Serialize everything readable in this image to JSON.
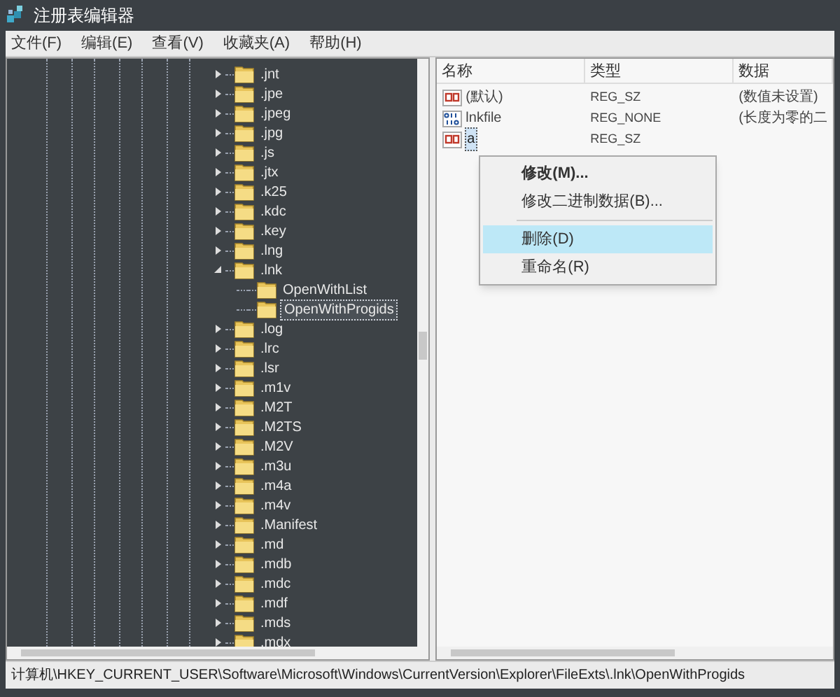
{
  "window": {
    "title": "注册表编辑器"
  },
  "menu": [
    "文件(F)",
    "编辑(E)",
    "查看(V)",
    "收藏夹(A)",
    "帮助(H)"
  ],
  "tree": [
    {
      "label": ".jnt",
      "expanded": false,
      "selected": false
    },
    {
      "label": ".jpe",
      "expanded": false,
      "selected": false
    },
    {
      "label": ".jpeg",
      "expanded": false,
      "selected": false
    },
    {
      "label": ".jpg",
      "expanded": false,
      "selected": false
    },
    {
      "label": ".js",
      "expanded": false,
      "selected": false
    },
    {
      "label": ".jtx",
      "expanded": false,
      "selected": false
    },
    {
      "label": ".k25",
      "expanded": false,
      "selected": false
    },
    {
      "label": ".kdc",
      "expanded": false,
      "selected": false
    },
    {
      "label": ".key",
      "expanded": false,
      "selected": false
    },
    {
      "label": ".lng",
      "expanded": false,
      "selected": false
    },
    {
      "label": ".lnk",
      "expanded": true,
      "selected": false,
      "children": [
        {
          "label": "OpenWithList",
          "selected": false
        },
        {
          "label": "OpenWithProgids",
          "selected": true
        }
      ]
    },
    {
      "label": ".log",
      "expanded": false,
      "selected": false
    },
    {
      "label": ".lrc",
      "expanded": false,
      "selected": false
    },
    {
      "label": ".lsr",
      "expanded": false,
      "selected": false
    },
    {
      "label": ".m1v",
      "expanded": false,
      "selected": false
    },
    {
      "label": ".M2T",
      "expanded": false,
      "selected": false
    },
    {
      "label": ".M2TS",
      "expanded": false,
      "selected": false
    },
    {
      "label": ".M2V",
      "expanded": false,
      "selected": false
    },
    {
      "label": ".m3u",
      "expanded": false,
      "selected": false
    },
    {
      "label": ".m4a",
      "expanded": false,
      "selected": false
    },
    {
      "label": ".m4v",
      "expanded": false,
      "selected": false
    },
    {
      "label": ".Manifest",
      "expanded": false,
      "selected": false
    },
    {
      "label": ".md",
      "expanded": false,
      "selected": false
    },
    {
      "label": ".mdb",
      "expanded": false,
      "selected": false
    },
    {
      "label": ".mdc",
      "expanded": false,
      "selected": false
    },
    {
      "label": ".mdf",
      "expanded": false,
      "selected": false
    },
    {
      "label": ".mds",
      "expanded": false,
      "selected": false
    },
    {
      "label": ".mdx",
      "expanded": false,
      "selected": false
    }
  ],
  "list": {
    "columns": [
      "名称",
      "类型",
      "数据"
    ],
    "rows": [
      {
        "kind": "string",
        "name": "(默认)",
        "type": "REG_SZ",
        "data": "(数值未设置)",
        "selected": false
      },
      {
        "kind": "binary",
        "name": "lnkfile",
        "type": "REG_NONE",
        "data": "(长度为零的二",
        "selected": false
      },
      {
        "kind": "string",
        "name": "a",
        "type": "REG_SZ",
        "selected": true
      }
    ]
  },
  "context_menu": [
    {
      "kind": "item",
      "label": "修改(M)...",
      "bold": true,
      "selected": false
    },
    {
      "kind": "item",
      "label": "修改二进制数据(B)...",
      "bold": false,
      "selected": false
    },
    {
      "kind": "separator"
    },
    {
      "kind": "item",
      "label": "删除(D)",
      "bold": false,
      "selected": true
    },
    {
      "kind": "item",
      "label": "重命名(R)",
      "bold": false,
      "selected": false
    }
  ],
  "status_bar": "计算机\\HKEY_CURRENT_USER\\Software\\Microsoft\\Windows\\CurrentVersion\\Explorer\\FileExts\\.lnk\\OpenWithProgids"
}
